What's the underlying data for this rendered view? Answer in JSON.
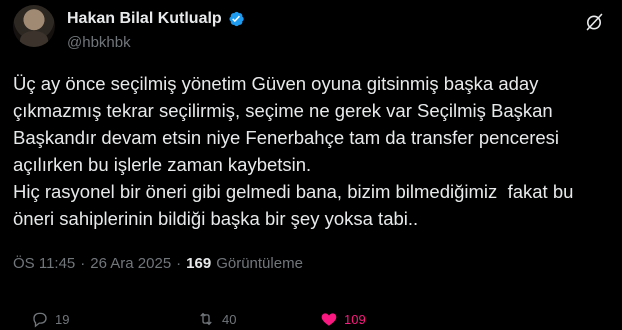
{
  "author": {
    "name": "Hakan Bilal Kutlualp",
    "handle": "@hbkhbk",
    "verified": true
  },
  "tweet": {
    "lines": [
      "Üç ay önce seçilmiş yönetim Güven oyuna gitsinmiş başka aday",
      "çıkmazmış tekrar seçilirmiş, seçime ne gerek var Seçilmiş Başkan",
      "Başkandır devam etsin niye Fenerbahçe tam da transfer penceresi",
      "açılırken bu işlerle zaman kaybetsin.",
      "Hiç rasyonel bir öneri gibi gelmedi bana, bizim bilmediğimiz  fakat bu",
      "öneri sahiplerinin bildiği başka bir şey yoksa tabi.."
    ]
  },
  "meta": {
    "time": "ÖS 11:45",
    "separator": "·",
    "date": "26 Ara 2025",
    "views_count": "169",
    "views_label": "Görüntüleme"
  },
  "actions": {
    "reply_count": "19",
    "retweet_count": "40",
    "like_count": "109"
  },
  "colors": {
    "background": "#000000",
    "text": "#e7e9ea",
    "secondary": "#71767b",
    "verified": "#1d9bf0",
    "like": "#f91880"
  }
}
